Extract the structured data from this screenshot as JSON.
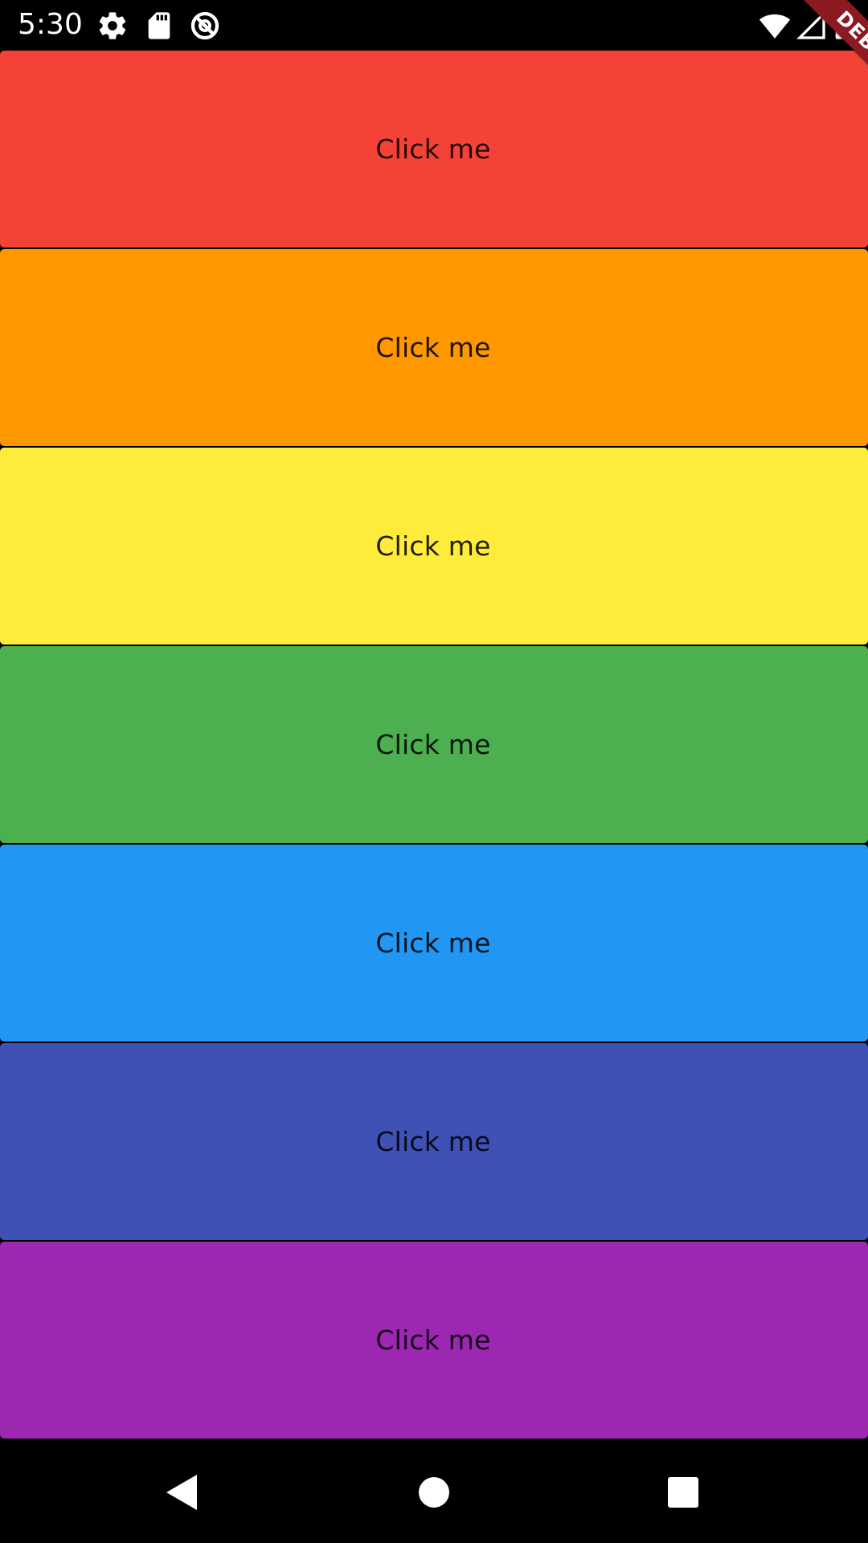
{
  "status_bar": {
    "time": "5:30",
    "left_icons": [
      "gear-icon",
      "sd-card-icon",
      "data-saver-icon"
    ],
    "right_icons": [
      "wifi-icon",
      "cell-signal-icon",
      "battery-icon"
    ]
  },
  "buttons": [
    {
      "label": "Click me",
      "color": "#F44336"
    },
    {
      "label": "Click me",
      "color": "#FF9800"
    },
    {
      "label": "Click me",
      "color": "#FFEB3B"
    },
    {
      "label": "Click me",
      "color": "#4CAF50"
    },
    {
      "label": "Click me",
      "color": "#2196F3"
    },
    {
      "label": "Click me",
      "color": "#3F51B5"
    },
    {
      "label": "Click me",
      "color": "#9C27B0"
    }
  ],
  "debug_banner": {
    "label": "DEBUG",
    "color": "#8B1A22"
  },
  "nav_bar": {
    "buttons": [
      "back-icon",
      "home-icon",
      "recents-icon"
    ]
  }
}
